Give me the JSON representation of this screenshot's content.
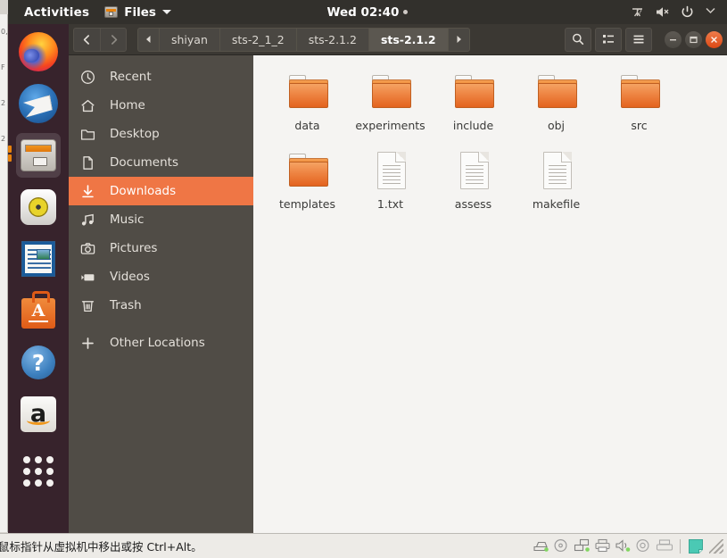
{
  "vm": {
    "status_text": "鼠标指针从虚拟机中移出或按 Ctrl+Alt。",
    "left_strip_fragments": [
      "0,",
      "F",
      "2",
      "2"
    ],
    "status_icons": [
      "harddisk-icon",
      "cd-icon",
      "network-icon",
      "printer-icon",
      "sound-icon",
      "disc-icon",
      "scanner-icon"
    ],
    "app_indicator_icon": "sticky-note-icon",
    "resize_grip_icon": "resize-grip-icon"
  },
  "panel": {
    "activities_label": "Activities",
    "app_name": "Files",
    "app_icon": "files-icon",
    "app_menu_caret_icon": "caret-down-icon",
    "clock": "Wed 02:40",
    "clock_dot_icon": "recording-dot-icon",
    "tray_icons": [
      "accessibility-icon",
      "volume-muted-icon",
      "power-icon",
      "caret-down-icon"
    ]
  },
  "dock": {
    "items": [
      {
        "name": "firefox",
        "label": "Firefox",
        "icon": "firefox-icon",
        "active": false
      },
      {
        "name": "thunderbird",
        "label": "Thunderbird Mail",
        "icon": "thunderbird-icon",
        "active": false
      },
      {
        "name": "files",
        "label": "Files",
        "icon": "files-icon",
        "active": true
      },
      {
        "name": "rhythmbox",
        "label": "Rhythmbox",
        "icon": "rhythmbox-icon",
        "active": false
      },
      {
        "name": "writer",
        "label": "LibreOffice Writer",
        "icon": "libreoffice-writer-icon",
        "active": false
      },
      {
        "name": "software",
        "label": "Ubuntu Software",
        "icon": "ubuntu-software-icon",
        "active": false
      },
      {
        "name": "help",
        "label": "Help",
        "icon": "help-icon",
        "active": false
      },
      {
        "name": "amazon",
        "label": "Amazon",
        "icon": "amazon-icon",
        "active": false
      },
      {
        "name": "show-apps",
        "label": "Show Applications",
        "icon": "app-grid-icon",
        "active": false
      }
    ]
  },
  "window": {
    "nav": {
      "back_icon": "chevron-left-icon",
      "forward_icon": "chevron-right-icon"
    },
    "breadcrumbs": {
      "left_arrow_icon": "caret-left-icon",
      "right_arrow_icon": "caret-right-icon",
      "items": [
        {
          "label": "shiyan",
          "active": false
        },
        {
          "label": "sts-2_1_2",
          "active": false
        },
        {
          "label": "sts-2.1.2",
          "active": false
        },
        {
          "label": "sts-2.1.2",
          "active": true
        }
      ]
    },
    "toolbar": [
      {
        "name": "search-button",
        "icon": "search-icon"
      },
      {
        "name": "view-options-button",
        "icon": "list-view-icon"
      },
      {
        "name": "menu-button",
        "icon": "hamburger-menu-icon"
      }
    ],
    "controls": [
      {
        "name": "minimize-button",
        "icon": "minimize-icon"
      },
      {
        "name": "maximize-button",
        "icon": "maximize-icon"
      },
      {
        "name": "close-button",
        "icon": "close-icon"
      }
    ],
    "accent_color": "#ef7645",
    "headerbar_color": "#3b3833",
    "sidebar_color": "#504c46"
  },
  "sidebar": {
    "items": [
      {
        "label": "Recent",
        "icon": "clock-icon",
        "selected": false
      },
      {
        "label": "Home",
        "icon": "home-icon",
        "selected": false
      },
      {
        "label": "Desktop",
        "icon": "folder-icon",
        "selected": false
      },
      {
        "label": "Documents",
        "icon": "document-icon",
        "selected": false
      },
      {
        "label": "Downloads",
        "icon": "download-icon",
        "selected": true
      },
      {
        "label": "Music",
        "icon": "music-icon",
        "selected": false
      },
      {
        "label": "Pictures",
        "icon": "camera-icon",
        "selected": false
      },
      {
        "label": "Videos",
        "icon": "video-icon",
        "selected": false
      },
      {
        "label": "Trash",
        "icon": "trash-icon",
        "selected": false
      }
    ],
    "other": {
      "label": "Other Locations",
      "icon": "plus-icon",
      "selected": false
    }
  },
  "files": {
    "items": [
      {
        "label": "data",
        "type": "folder"
      },
      {
        "label": "experiments",
        "type": "folder"
      },
      {
        "label": "include",
        "type": "folder"
      },
      {
        "label": "obj",
        "type": "folder"
      },
      {
        "label": "src",
        "type": "folder"
      },
      {
        "label": "templates",
        "type": "folder"
      },
      {
        "label": "1.txt",
        "type": "text"
      },
      {
        "label": "assess",
        "type": "text"
      },
      {
        "label": "makefile",
        "type": "text"
      }
    ]
  }
}
